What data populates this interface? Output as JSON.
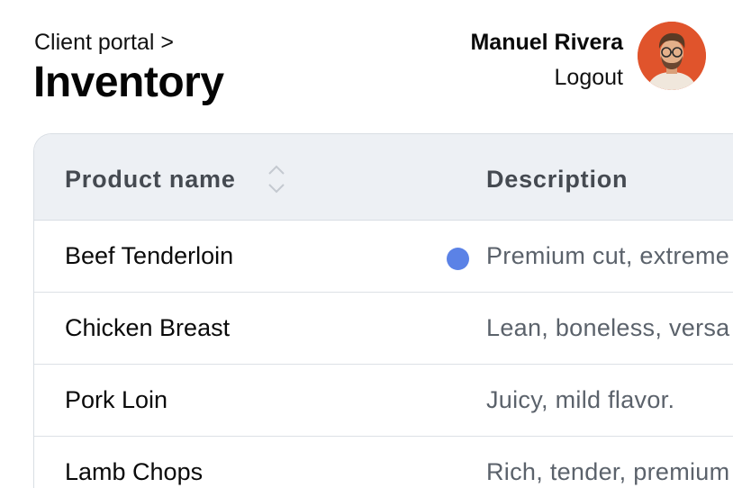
{
  "header": {
    "breadcrumb": "Client portal >",
    "title": "Inventory",
    "user_name": "Manuel Rivera",
    "logout_label": "Logout",
    "avatar_icon": "avatar-photo",
    "avatar_color": "#e0542c"
  },
  "table": {
    "columns": [
      "Product name",
      "Description"
    ],
    "sort_icon": "sort-icon",
    "rows": [
      {
        "name": "Beef Tenderloin",
        "description": "Premium cut, extreme",
        "indicator": true
      },
      {
        "name": "Chicken Breast",
        "description": "Lean, boneless, versa",
        "indicator": false
      },
      {
        "name": "Pork Loin",
        "description": "Juicy, mild flavor.",
        "indicator": false
      },
      {
        "name": "Lamb Chops",
        "description": "Rich, tender, premium",
        "indicator": false
      }
    ],
    "indicator_color": "#5b82e6"
  }
}
